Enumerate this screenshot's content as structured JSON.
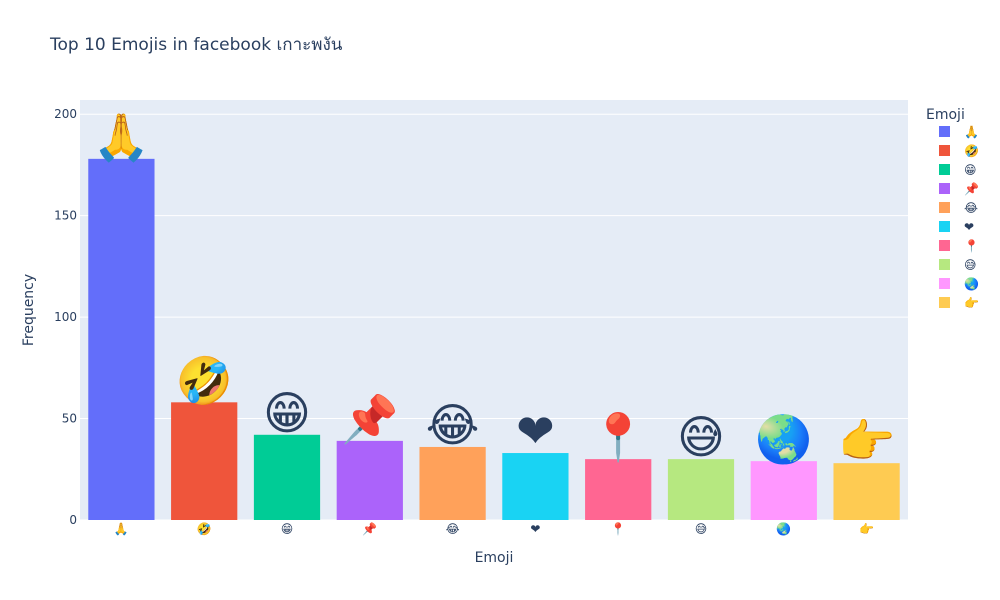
{
  "chart_data": {
    "type": "bar",
    "title": "Top 10 Emojis in facebook เกาะพงัน",
    "xlabel": "Emoji",
    "ylabel": "Frequency",
    "ylim": [
      0,
      207
    ],
    "yticks": [
      0,
      50,
      100,
      150,
      200
    ],
    "grid": true,
    "legend_title": "Emoji",
    "legend_position": "right",
    "categories": [
      "🙏",
      "🤣",
      "😁",
      "📌",
      "😂",
      "❤",
      "📍",
      "😅",
      "🌏",
      "👉"
    ],
    "values": [
      178,
      58,
      42,
      39,
      36,
      33,
      30,
      30,
      29,
      28
    ],
    "colors": [
      "#636efa",
      "#EF553B",
      "#00cc96",
      "#ab63fa",
      "#FFA15A",
      "#19d3f3",
      "#FF6692",
      "#B6E880",
      "#FF97FF",
      "#FECB52"
    ],
    "bar_text_labels": true
  }
}
